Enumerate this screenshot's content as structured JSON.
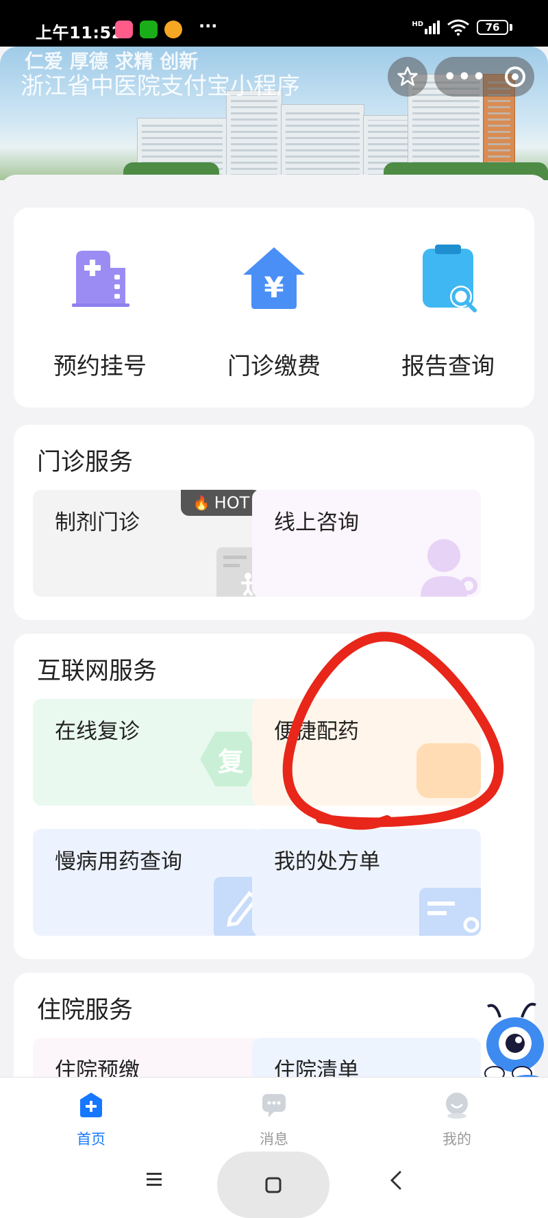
{
  "status_bar": {
    "time": "上午11:52",
    "signal": "HD",
    "battery": "76"
  },
  "banner": {
    "slogan": "仁爱 厚德 求精 创新",
    "title": "浙江省中医院支付宝小程序"
  },
  "quick_actions": [
    {
      "label": "预约挂号",
      "icon": "hospital-icon"
    },
    {
      "label": "门诊缴费",
      "icon": "yuan-house-icon"
    },
    {
      "label": "报告查询",
      "icon": "report-search-icon"
    }
  ],
  "sections": {
    "outpatient": {
      "title": "门诊服务",
      "tiles": [
        {
          "label": "制剂门诊",
          "badge": "HOT",
          "bg": "#f3f3f4"
        },
        {
          "label": "线上咨询",
          "bg": "#fbf5fd"
        }
      ]
    },
    "internet": {
      "title": "互联网服务",
      "tiles": [
        {
          "label": "在线复诊",
          "deco": "复",
          "bg": "#eaf9f0"
        },
        {
          "label": "便捷配药",
          "bg": "#fff5ea"
        },
        {
          "label": "慢病用药查询",
          "bg": "#edf3fe"
        },
        {
          "label": "我的处方单",
          "bg": "#edf3fe"
        }
      ]
    },
    "inpatient": {
      "title": "住院服务",
      "tiles": [
        {
          "label": "住院预缴"
        },
        {
          "label": "住院清单"
        }
      ]
    }
  },
  "tabbar": [
    {
      "label": "首页",
      "active": true
    },
    {
      "label": "消息",
      "active": false
    },
    {
      "label": "我的",
      "active": false
    }
  ],
  "colors": {
    "accent": "#1677ff",
    "annotation": "#e8261a"
  }
}
